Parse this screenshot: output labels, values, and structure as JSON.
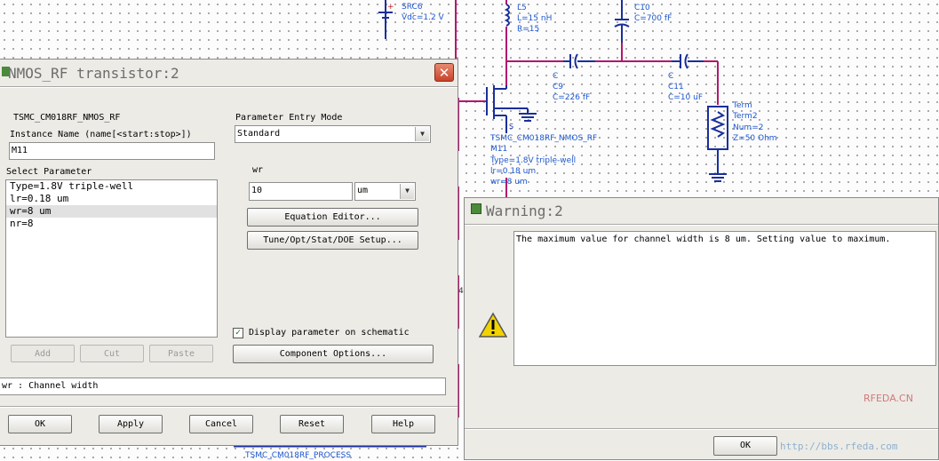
{
  "schematic": {
    "src6": {
      "name": "SRC6",
      "vdc": "Vdc=1.2 V"
    },
    "l5": {
      "name": "L5",
      "l": "L=15 nH",
      "r": "R=15"
    },
    "c10": {
      "type": "C",
      "name": "C10",
      "value": "C=700 fF"
    },
    "c9": {
      "type": "C",
      "name": "C9",
      "value": "C=226 fF"
    },
    "c11": {
      "type": "C",
      "name": "C11",
      "value": "C=10 uF"
    },
    "term2": {
      "type": "Term",
      "name": "Term2",
      "num": "Num=2",
      "z": "Z=50 Ohm"
    },
    "transistor": {
      "model": "TSMC_CM018RF_NMOS_RF",
      "name": "M11",
      "type": "Type=1.8V triple-well",
      "lr": "lr=0.18 um",
      "wr": "wr=8 um",
      "pin_s": "S"
    },
    "process_label": "TSMC_CM018RF_PROCESS",
    "stray_label": "4"
  },
  "param_dialog": {
    "title": "NMOS_RF transistor:2",
    "component_name": "TSMC_CM018RF_NMOS_RF",
    "instance_name_label": "Instance Name   (name[<start:stop>])",
    "instance_name_value": "M11",
    "select_parameter_label": "Select Parameter",
    "parameters": [
      "Type=1.8V triple-well",
      "lr=0.18 um",
      "wr=8 um",
      "nr=8"
    ],
    "entry_mode_label": "Parameter Entry Mode",
    "entry_mode_value": "Standard",
    "param_name": "wr",
    "param_value": "10",
    "param_unit": "um",
    "equation_editor_btn": "Equation Editor...",
    "tune_btn": "Tune/Opt/Stat/DOE Setup...",
    "add_btn": "Add",
    "cut_btn": "Cut",
    "paste_btn": "Paste",
    "display_checkbox_label": "Display parameter on schematic",
    "component_options_btn": "Component Options...",
    "description": "wr : Channel width",
    "ok_btn": "OK",
    "apply_btn": "Apply",
    "cancel_btn": "Cancel",
    "reset_btn": "Reset",
    "help_btn": "Help"
  },
  "warning_dialog": {
    "title": "Warning:2",
    "message": "The maximum value for channel width is 8 um.  Setting value to maximum.",
    "ok_btn": "OK"
  },
  "watermark": {
    "line1": "RFEDA.CN",
    "line2": "http://bbs.rfeda.com"
  },
  "colors": {
    "wire": "#b0186e",
    "label": "#1d58d0",
    "component": "#1a2f9a",
    "dialog_bg": "#ecebe6",
    "close_btn": "#c8432a",
    "warning_yellow": "#f2d200"
  }
}
